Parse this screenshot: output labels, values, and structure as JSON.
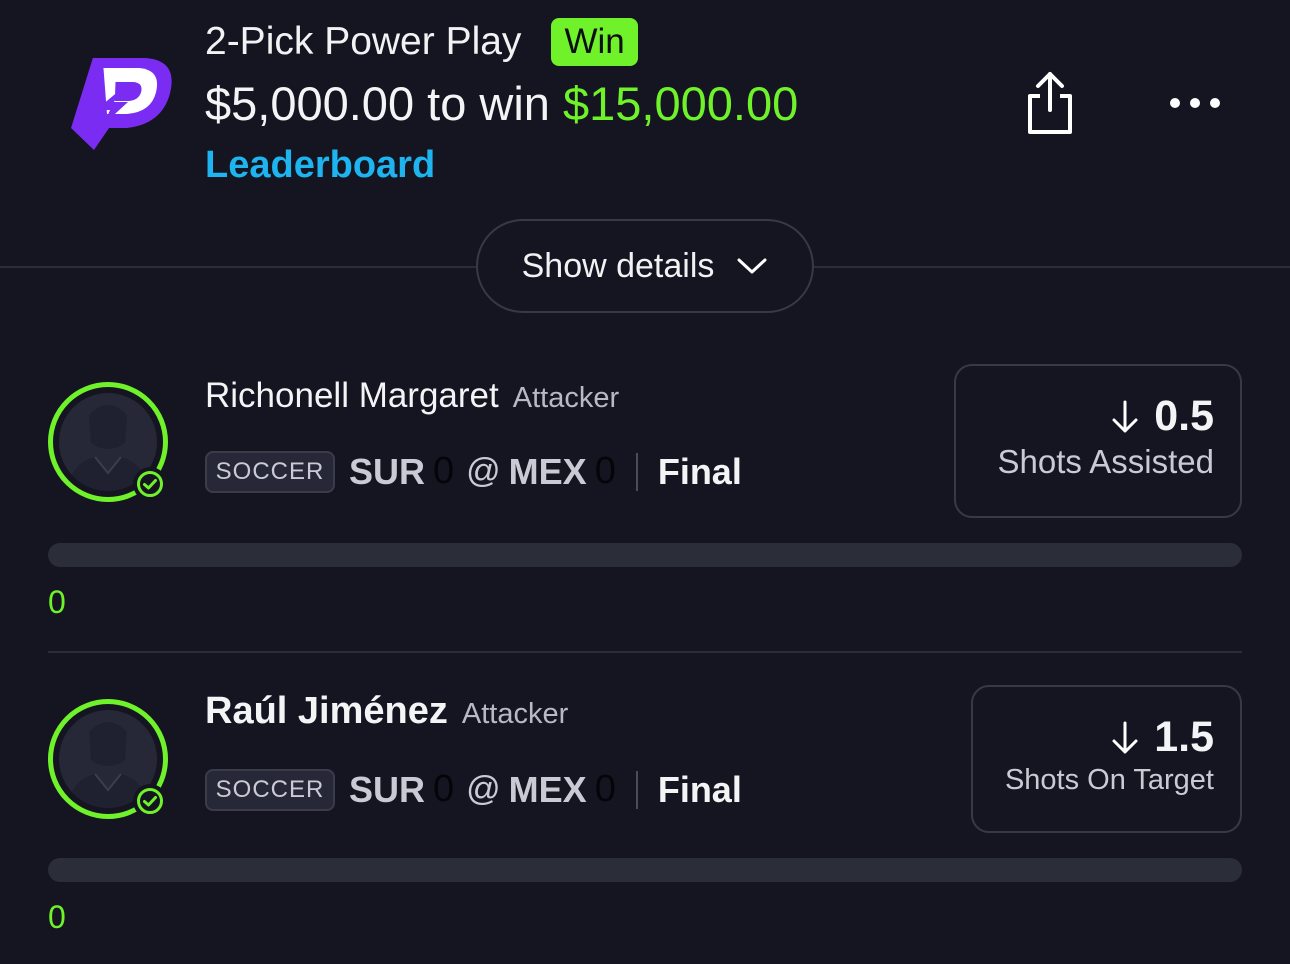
{
  "header": {
    "title": "2-Pick Power Play",
    "result_badge": "Win",
    "stake": "$5,000.00",
    "to_win_label": "to win",
    "payout": "$15,000.00",
    "leaderboard_label": "Leaderboard"
  },
  "details_toggle": {
    "label": "Show details"
  },
  "picks": [
    {
      "player_name": "Richonell Margaret",
      "position": "Attacker",
      "sport": "SOCCER",
      "away_team": "SUR",
      "away_score": "0",
      "at_symbol": "@",
      "home_team": "MEX",
      "home_score": "0",
      "status": "Final",
      "line_value": "0.5",
      "direction": "under",
      "stat_name": "Shots Assisted",
      "current_value": "0",
      "progress_fraction": 0
    },
    {
      "player_name": "Raúl Jiménez",
      "position": "Attacker",
      "sport": "SOCCER",
      "away_team": "SUR",
      "away_score": "0",
      "at_symbol": "@",
      "home_team": "MEX",
      "home_score": "0",
      "status": "Final",
      "line_value": "1.5",
      "direction": "under",
      "stat_name": "Shots On Target",
      "current_value": "0",
      "progress_fraction": 0
    }
  ],
  "icons": {
    "logo": "prizepicks-logo",
    "share": "share-icon",
    "more": "more-icon",
    "chevron": "chevron-down-icon",
    "check": "check-circle-icon",
    "arrow": "arrow-down-icon"
  },
  "colors": {
    "background": "#141520",
    "accent_green": "#6ff22a",
    "link_blue": "#1db4ef",
    "brand_purple": "#7b2cf2"
  }
}
